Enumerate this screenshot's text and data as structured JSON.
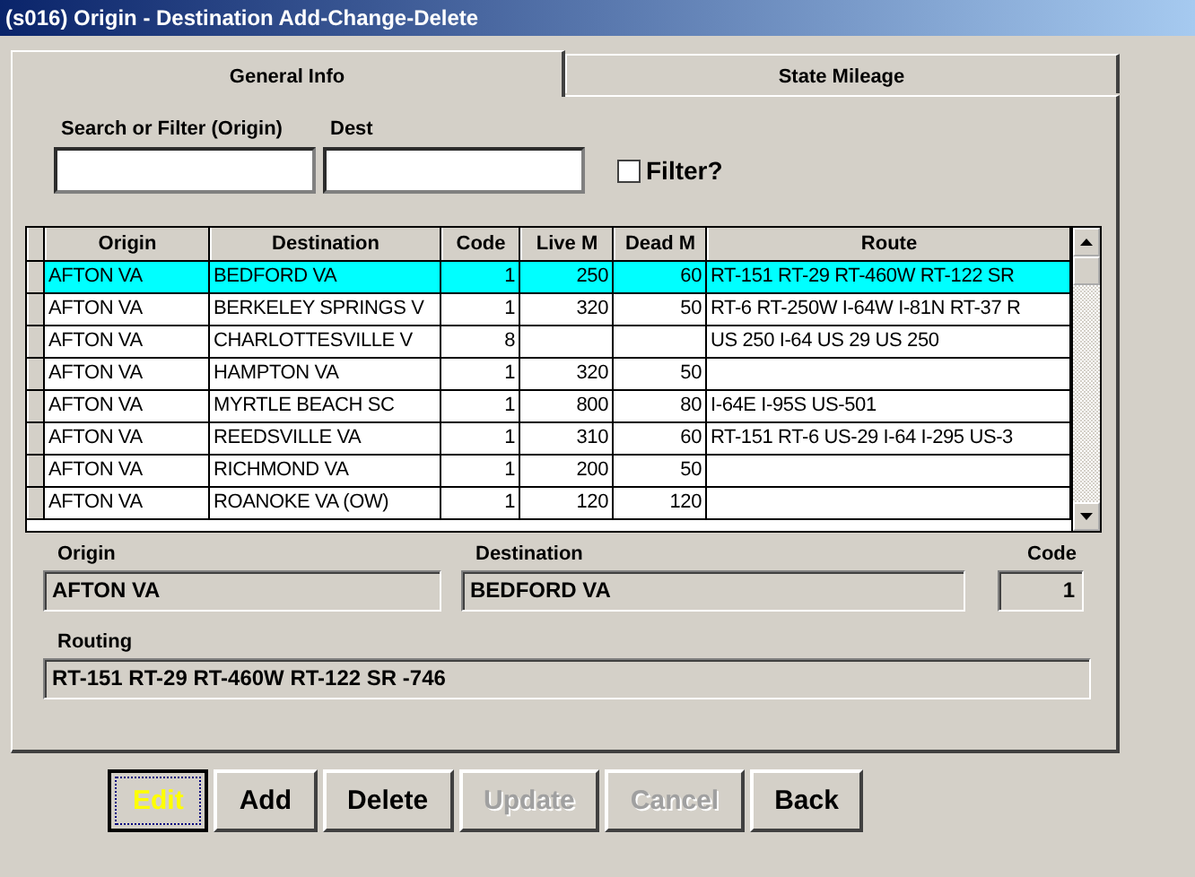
{
  "window": {
    "title": "(s016)  Origin - Destination Add-Change-Delete"
  },
  "tabs": [
    {
      "label": "General Info",
      "selected": true
    },
    {
      "label": "State Mileage",
      "selected": false
    }
  ],
  "search": {
    "origin_label": "Search or Filter (Origin)",
    "dest_label": "Dest",
    "filter_label": "Filter?",
    "filter_checked": false
  },
  "table": {
    "columns": [
      "Origin",
      "Destination",
      "Code",
      "Live M",
      "Dead M",
      "Route"
    ],
    "rows": [
      {
        "cells": [
          "AFTON VA",
          "BEDFORD VA",
          "1",
          "250",
          "60",
          "RT-151 RT-29 RT-460W RT-122 SR"
        ],
        "selected": true
      },
      {
        "cells": [
          "AFTON VA",
          "BERKELEY SPRINGS V",
          "1",
          "320",
          "50",
          "RT-6 RT-250W I-64W I-81N RT-37 R"
        ],
        "selected": false
      },
      {
        "cells": [
          "AFTON VA",
          "CHARLOTTESVILLE V",
          "8",
          "",
          "",
          "US 250 I-64 US 29 US 250"
        ],
        "selected": false
      },
      {
        "cells": [
          "AFTON VA",
          "HAMPTON VA",
          "1",
          "320",
          "50",
          ""
        ],
        "selected": false
      },
      {
        "cells": [
          "AFTON VA",
          "MYRTLE BEACH SC",
          "1",
          "800",
          "80",
          "I-64E I-95S US-501"
        ],
        "selected": false
      },
      {
        "cells": [
          "AFTON VA",
          "REEDSVILLE VA",
          "1",
          "310",
          "60",
          "RT-151 RT-6 US-29 I-64 I-295 US-3"
        ],
        "selected": false
      },
      {
        "cells": [
          "AFTON VA",
          "RICHMOND VA",
          "1",
          "200",
          "50",
          ""
        ],
        "selected": false
      },
      {
        "cells": [
          "AFTON VA",
          "ROANOKE VA (OW)",
          "1",
          "120",
          "120",
          ""
        ],
        "selected": false
      }
    ]
  },
  "detail": {
    "origin_label": "Origin",
    "origin": "AFTON VA",
    "destination_label": "Destination",
    "destination": "BEDFORD VA",
    "code_label": "Code",
    "code": "1",
    "routing_label": "Routing",
    "routing": "RT-151 RT-29 RT-460W RT-122 SR -746"
  },
  "buttons": [
    {
      "label": "Edit",
      "disabled": false,
      "focused": true
    },
    {
      "label": "Add",
      "disabled": false,
      "focused": false
    },
    {
      "label": "Delete",
      "disabled": false,
      "focused": false
    },
    {
      "label": "Update",
      "disabled": true,
      "focused": false
    },
    {
      "label": "Cancel",
      "disabled": true,
      "focused": false
    },
    {
      "label": "Back",
      "disabled": false,
      "focused": false
    }
  ]
}
